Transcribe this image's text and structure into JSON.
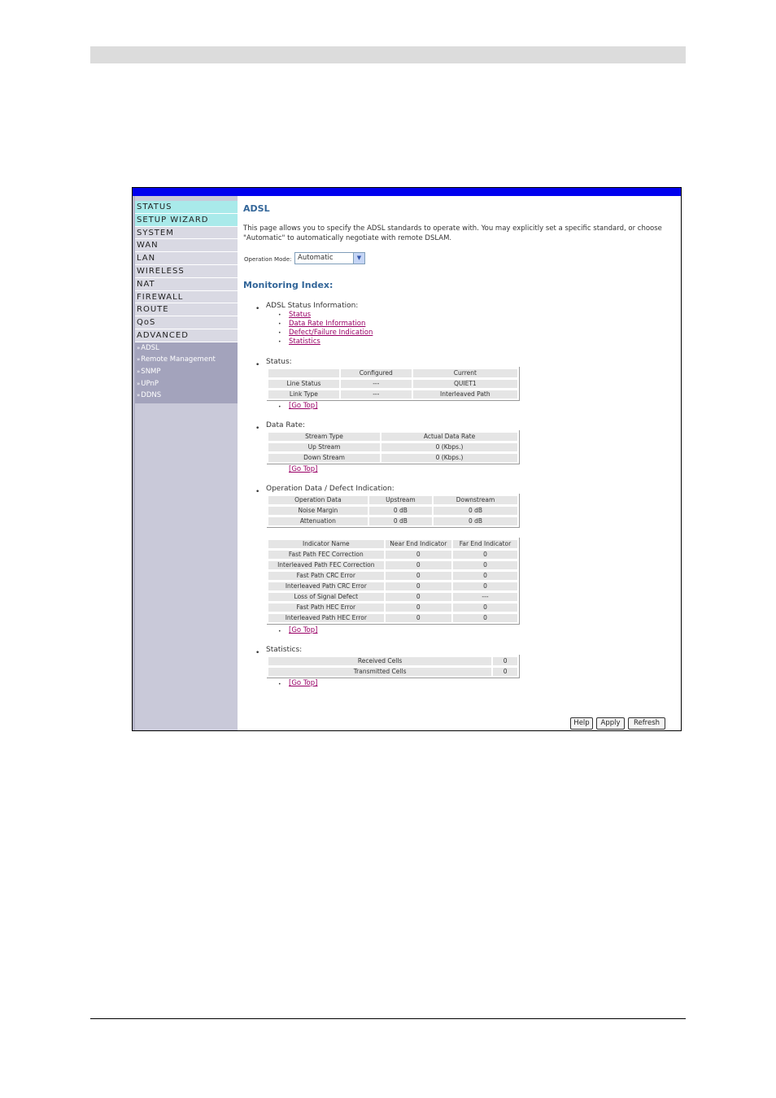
{
  "menu": [
    {
      "label": "STATUS",
      "highlight": true
    },
    {
      "label": "SETUP WIZARD",
      "highlight": true
    },
    {
      "label": "SYSTEM",
      "highlight": false
    },
    {
      "label": "WAN",
      "highlight": false
    },
    {
      "label": "LAN",
      "highlight": false
    },
    {
      "label": "WIRELESS",
      "highlight": false
    },
    {
      "label": "NAT",
      "highlight": false
    },
    {
      "label": "FIREWALL",
      "highlight": false
    },
    {
      "label": "ROUTE",
      "highlight": false
    },
    {
      "label": "QoS",
      "highlight": false
    },
    {
      "label": "ADVANCED",
      "highlight": false
    }
  ],
  "submenu": [
    "ADSL",
    "Remote Management",
    "SNMP",
    "UPnP",
    "DDNS"
  ],
  "submenu_arrow": "»",
  "page": {
    "title": "ADSL",
    "description": "This page allows you to specify the ADSL standards to operate with. You may explicitly set a specific standard, or choose \"Automatic\" to automatically negotiate with remote DSLAM.",
    "op_mode_label": "Operation Mode:",
    "op_mode_value": "Automatic",
    "monitoring_title": "Monitoring Index:"
  },
  "index": {
    "heading": "ADSL Status Information:",
    "links": [
      "Status",
      "Data Rate Information",
      "Defect/Failure Indication",
      "Statistics"
    ]
  },
  "go_top": "[Go Top]",
  "status": {
    "heading": "Status:",
    "headers": [
      "",
      "Configured",
      "Current"
    ],
    "rows": [
      [
        "Line Status",
        "---",
        "QUIET1"
      ],
      [
        "Link Type",
        "---",
        "Interleaved Path"
      ]
    ]
  },
  "data_rate": {
    "heading": "Data Rate:",
    "headers": [
      "Stream Type",
      "Actual Data Rate"
    ],
    "rows": [
      [
        "Up Stream",
        "0 (Kbps.)"
      ],
      [
        "Down Stream",
        "0 (Kbps.)"
      ]
    ]
  },
  "operation": {
    "heading": "Operation Data / Defect Indication:",
    "headers": [
      "Operation Data",
      "Upstream",
      "Downstream"
    ],
    "rows": [
      [
        "Noise Margin",
        "0 dB",
        "0 dB"
      ],
      [
        "Attenuation",
        "0 dB",
        "0 dB"
      ]
    ]
  },
  "indicator": {
    "headers": [
      "Indicator Name",
      "Near End Indicator",
      "Far End Indicator"
    ],
    "rows": [
      [
        "Fast Path FEC Correction",
        "0",
        "0"
      ],
      [
        "Interleaved Path FEC Correction",
        "0",
        "0"
      ],
      [
        "Fast Path CRC Error",
        "0",
        "0"
      ],
      [
        "Interleaved Path CRC Error",
        "0",
        "0"
      ],
      [
        "Loss of Signal Defect",
        "0",
        "---"
      ],
      [
        "Fast Path HEC Error",
        "0",
        "0"
      ],
      [
        "Interleaved Path HEC Error",
        "0",
        "0"
      ]
    ]
  },
  "statistics": {
    "heading": "Statistics:",
    "rows": [
      [
        "Received Cells",
        "0"
      ],
      [
        "Transmitted Cells",
        "0"
      ]
    ]
  },
  "buttons": {
    "help": "Help",
    "apply": "Apply",
    "refresh": "Refresh"
  },
  "colors": {
    "top_bar": "#0000ee",
    "title": "#336699",
    "link": "#990066",
    "sidebar": "#c9c9d9",
    "highlight": "#a9eaea"
  }
}
